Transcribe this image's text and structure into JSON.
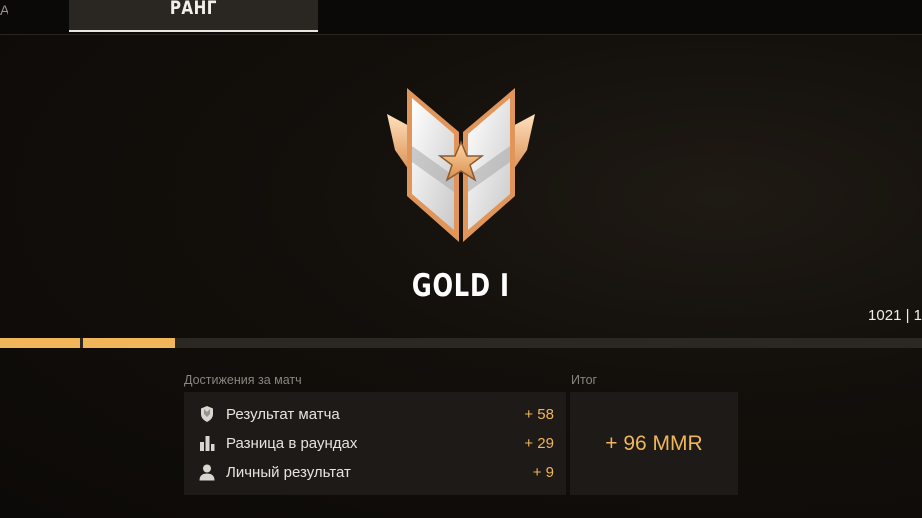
{
  "tabs": {
    "left_partial": "A",
    "ranks": "РАНГ"
  },
  "rank": {
    "name": "GOLD I",
    "badge_icon": "winged-star-rank-badge-icon",
    "mmr_counter": "1021 | 1",
    "progress_fraction": 0.19
  },
  "achievements": {
    "header": "Достижения за матч",
    "rows": [
      {
        "icon": "shield-icon",
        "label": "Результат матча",
        "value": "+ 58"
      },
      {
        "icon": "bar-chart-icon",
        "label": "Разница в раундах",
        "value": "+ 29"
      },
      {
        "icon": "person-icon",
        "label": "Личный результат",
        "value": "+ 9"
      }
    ]
  },
  "total": {
    "header": "Итог",
    "value": "+ 96 MMR"
  },
  "colors": {
    "accent": "#f1b55a",
    "background": "#0c0a08",
    "panel": "#1d1a17"
  }
}
